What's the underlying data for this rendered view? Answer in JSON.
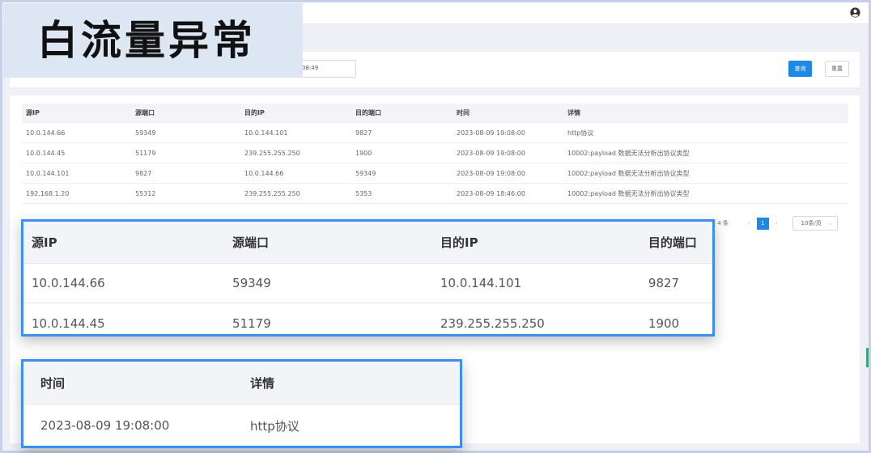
{
  "banner": {
    "title": "白流量异常"
  },
  "filter": {
    "time_value": "‌08:49",
    "query_label": "查询",
    "reset_label": "重置"
  },
  "table": {
    "columns": [
      "源IP",
      "源端口",
      "目的IP",
      "目的端口",
      "时间",
      "详情"
    ],
    "rows": [
      [
        "10.0.144.66",
        "59349",
        "10.0.144.101",
        "9827",
        "2023-08-09 19:08:00",
        "http协议"
      ],
      [
        "10.0.144.45",
        "51179",
        "239.255.255.250",
        "1900",
        "2023-08-09 19:08:00",
        "10002:payload 数据无法分析出协议类型"
      ],
      [
        "10.0.144.101",
        "9827",
        "10.0.144.66",
        "59349",
        "2023-08-09 19:08:00",
        "10002:payload 数据无法分析出协议类型"
      ],
      [
        "192.168.1.20",
        "55312",
        "239.255.255.250",
        "5353",
        "2023-08-09 18:46:00",
        "10002:payload 数据无法分析出协议类型"
      ]
    ]
  },
  "pagination": {
    "total": "共 4 条",
    "current_page": "1",
    "page_size": "10条/页",
    "prev": "‹",
    "next": "›",
    "dropdown": "⌄"
  },
  "zoom1": {
    "columns": [
      "源IP",
      "源端口",
      "目的IP",
      "目的端口"
    ],
    "rows": [
      [
        "10.0.144.66",
        "59349",
        "10.0.144.101",
        "9827"
      ],
      [
        "10.0.144.45",
        "51179",
        "239.255.255.250",
        "1900"
      ]
    ]
  },
  "zoom2": {
    "columns": [
      "时间",
      "详情"
    ],
    "rows": [
      [
        "2023-08-09 19:08:00",
        "http协议"
      ]
    ]
  },
  "colors": {
    "accent": "#1e88e5",
    "highlight_border": "#3b8ff0",
    "banner_bg": "#dde6f3"
  },
  "icons": {
    "user": "user-circle-icon"
  }
}
